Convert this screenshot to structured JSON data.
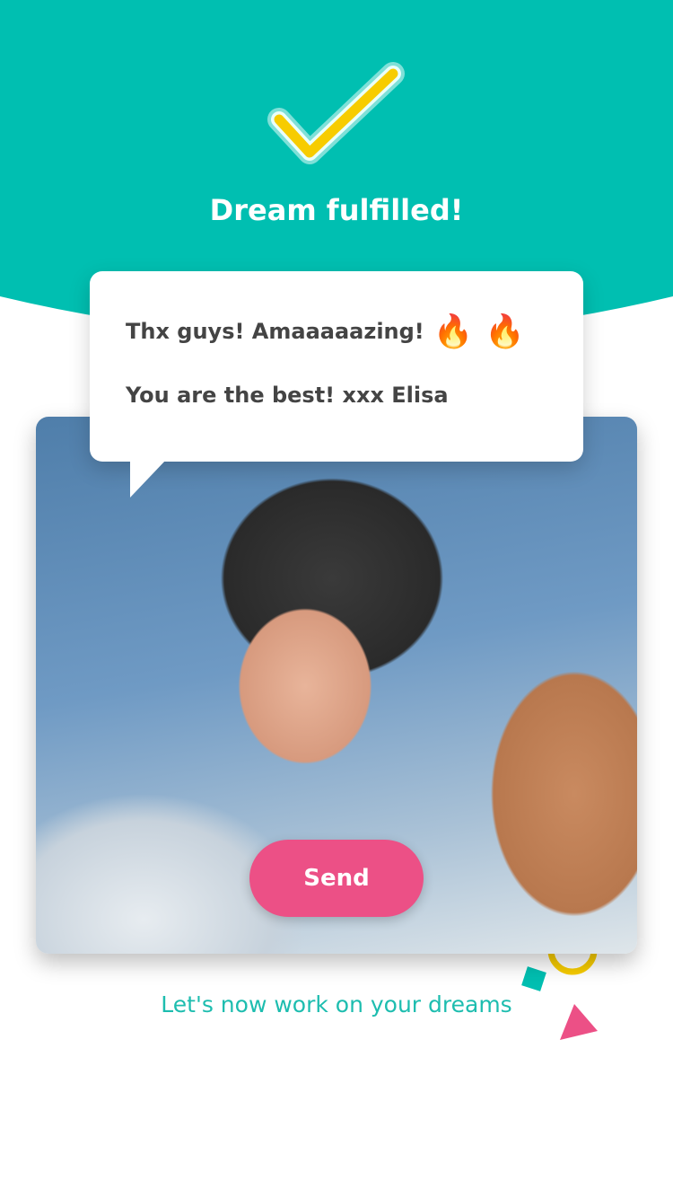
{
  "header": {
    "title": "Dream fulfilled!",
    "icon": "checkmark-icon"
  },
  "message": {
    "line1": "Thx guys! Amaaaaazing!",
    "emoji": "🔥 🔥",
    "line2": "You are the best! xxx Elisa"
  },
  "actions": {
    "send_label": "Send"
  },
  "footer": {
    "text": "Let's now work on your dreams"
  },
  "colors": {
    "teal": "#00BFB1",
    "yellow": "#F7CC00",
    "pink": "#EC5086"
  }
}
